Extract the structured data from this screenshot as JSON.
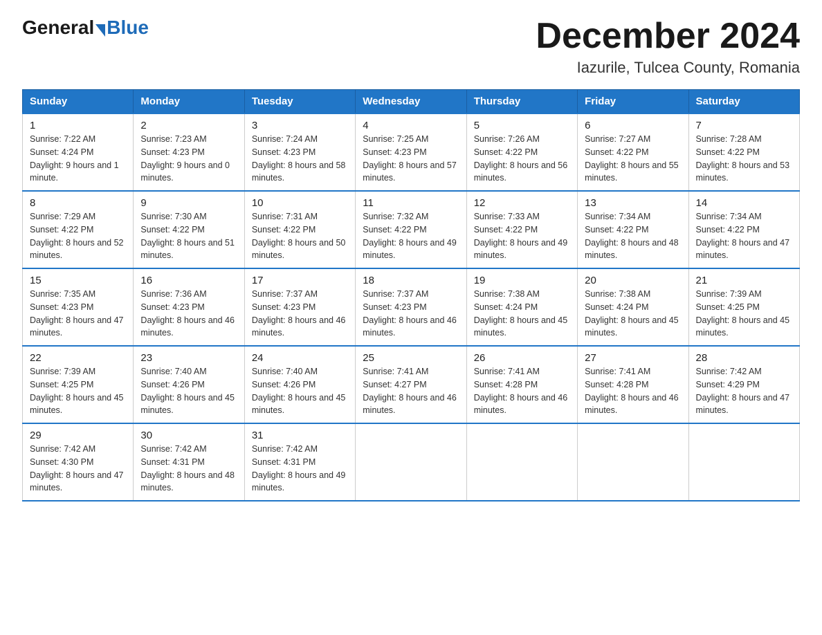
{
  "header": {
    "logo_general": "General",
    "logo_blue": "Blue",
    "month_year": "December 2024",
    "location": "Iazurile, Tulcea County, Romania"
  },
  "days_of_week": [
    "Sunday",
    "Monday",
    "Tuesday",
    "Wednesday",
    "Thursday",
    "Friday",
    "Saturday"
  ],
  "weeks": [
    [
      {
        "day": "1",
        "sunrise": "Sunrise: 7:22 AM",
        "sunset": "Sunset: 4:24 PM",
        "daylight": "Daylight: 9 hours and 1 minute."
      },
      {
        "day": "2",
        "sunrise": "Sunrise: 7:23 AM",
        "sunset": "Sunset: 4:23 PM",
        "daylight": "Daylight: 9 hours and 0 minutes."
      },
      {
        "day": "3",
        "sunrise": "Sunrise: 7:24 AM",
        "sunset": "Sunset: 4:23 PM",
        "daylight": "Daylight: 8 hours and 58 minutes."
      },
      {
        "day": "4",
        "sunrise": "Sunrise: 7:25 AM",
        "sunset": "Sunset: 4:23 PM",
        "daylight": "Daylight: 8 hours and 57 minutes."
      },
      {
        "day": "5",
        "sunrise": "Sunrise: 7:26 AM",
        "sunset": "Sunset: 4:22 PM",
        "daylight": "Daylight: 8 hours and 56 minutes."
      },
      {
        "day": "6",
        "sunrise": "Sunrise: 7:27 AM",
        "sunset": "Sunset: 4:22 PM",
        "daylight": "Daylight: 8 hours and 55 minutes."
      },
      {
        "day": "7",
        "sunrise": "Sunrise: 7:28 AM",
        "sunset": "Sunset: 4:22 PM",
        "daylight": "Daylight: 8 hours and 53 minutes."
      }
    ],
    [
      {
        "day": "8",
        "sunrise": "Sunrise: 7:29 AM",
        "sunset": "Sunset: 4:22 PM",
        "daylight": "Daylight: 8 hours and 52 minutes."
      },
      {
        "day": "9",
        "sunrise": "Sunrise: 7:30 AM",
        "sunset": "Sunset: 4:22 PM",
        "daylight": "Daylight: 8 hours and 51 minutes."
      },
      {
        "day": "10",
        "sunrise": "Sunrise: 7:31 AM",
        "sunset": "Sunset: 4:22 PM",
        "daylight": "Daylight: 8 hours and 50 minutes."
      },
      {
        "day": "11",
        "sunrise": "Sunrise: 7:32 AM",
        "sunset": "Sunset: 4:22 PM",
        "daylight": "Daylight: 8 hours and 49 minutes."
      },
      {
        "day": "12",
        "sunrise": "Sunrise: 7:33 AM",
        "sunset": "Sunset: 4:22 PM",
        "daylight": "Daylight: 8 hours and 49 minutes."
      },
      {
        "day": "13",
        "sunrise": "Sunrise: 7:34 AM",
        "sunset": "Sunset: 4:22 PM",
        "daylight": "Daylight: 8 hours and 48 minutes."
      },
      {
        "day": "14",
        "sunrise": "Sunrise: 7:34 AM",
        "sunset": "Sunset: 4:22 PM",
        "daylight": "Daylight: 8 hours and 47 minutes."
      }
    ],
    [
      {
        "day": "15",
        "sunrise": "Sunrise: 7:35 AM",
        "sunset": "Sunset: 4:23 PM",
        "daylight": "Daylight: 8 hours and 47 minutes."
      },
      {
        "day": "16",
        "sunrise": "Sunrise: 7:36 AM",
        "sunset": "Sunset: 4:23 PM",
        "daylight": "Daylight: 8 hours and 46 minutes."
      },
      {
        "day": "17",
        "sunrise": "Sunrise: 7:37 AM",
        "sunset": "Sunset: 4:23 PM",
        "daylight": "Daylight: 8 hours and 46 minutes."
      },
      {
        "day": "18",
        "sunrise": "Sunrise: 7:37 AM",
        "sunset": "Sunset: 4:23 PM",
        "daylight": "Daylight: 8 hours and 46 minutes."
      },
      {
        "day": "19",
        "sunrise": "Sunrise: 7:38 AM",
        "sunset": "Sunset: 4:24 PM",
        "daylight": "Daylight: 8 hours and 45 minutes."
      },
      {
        "day": "20",
        "sunrise": "Sunrise: 7:38 AM",
        "sunset": "Sunset: 4:24 PM",
        "daylight": "Daylight: 8 hours and 45 minutes."
      },
      {
        "day": "21",
        "sunrise": "Sunrise: 7:39 AM",
        "sunset": "Sunset: 4:25 PM",
        "daylight": "Daylight: 8 hours and 45 minutes."
      }
    ],
    [
      {
        "day": "22",
        "sunrise": "Sunrise: 7:39 AM",
        "sunset": "Sunset: 4:25 PM",
        "daylight": "Daylight: 8 hours and 45 minutes."
      },
      {
        "day": "23",
        "sunrise": "Sunrise: 7:40 AM",
        "sunset": "Sunset: 4:26 PM",
        "daylight": "Daylight: 8 hours and 45 minutes."
      },
      {
        "day": "24",
        "sunrise": "Sunrise: 7:40 AM",
        "sunset": "Sunset: 4:26 PM",
        "daylight": "Daylight: 8 hours and 45 minutes."
      },
      {
        "day": "25",
        "sunrise": "Sunrise: 7:41 AM",
        "sunset": "Sunset: 4:27 PM",
        "daylight": "Daylight: 8 hours and 46 minutes."
      },
      {
        "day": "26",
        "sunrise": "Sunrise: 7:41 AM",
        "sunset": "Sunset: 4:28 PM",
        "daylight": "Daylight: 8 hours and 46 minutes."
      },
      {
        "day": "27",
        "sunrise": "Sunrise: 7:41 AM",
        "sunset": "Sunset: 4:28 PM",
        "daylight": "Daylight: 8 hours and 46 minutes."
      },
      {
        "day": "28",
        "sunrise": "Sunrise: 7:42 AM",
        "sunset": "Sunset: 4:29 PM",
        "daylight": "Daylight: 8 hours and 47 minutes."
      }
    ],
    [
      {
        "day": "29",
        "sunrise": "Sunrise: 7:42 AM",
        "sunset": "Sunset: 4:30 PM",
        "daylight": "Daylight: 8 hours and 47 minutes."
      },
      {
        "day": "30",
        "sunrise": "Sunrise: 7:42 AM",
        "sunset": "Sunset: 4:31 PM",
        "daylight": "Daylight: 8 hours and 48 minutes."
      },
      {
        "day": "31",
        "sunrise": "Sunrise: 7:42 AM",
        "sunset": "Sunset: 4:31 PM",
        "daylight": "Daylight: 8 hours and 49 minutes."
      },
      null,
      null,
      null,
      null
    ]
  ]
}
